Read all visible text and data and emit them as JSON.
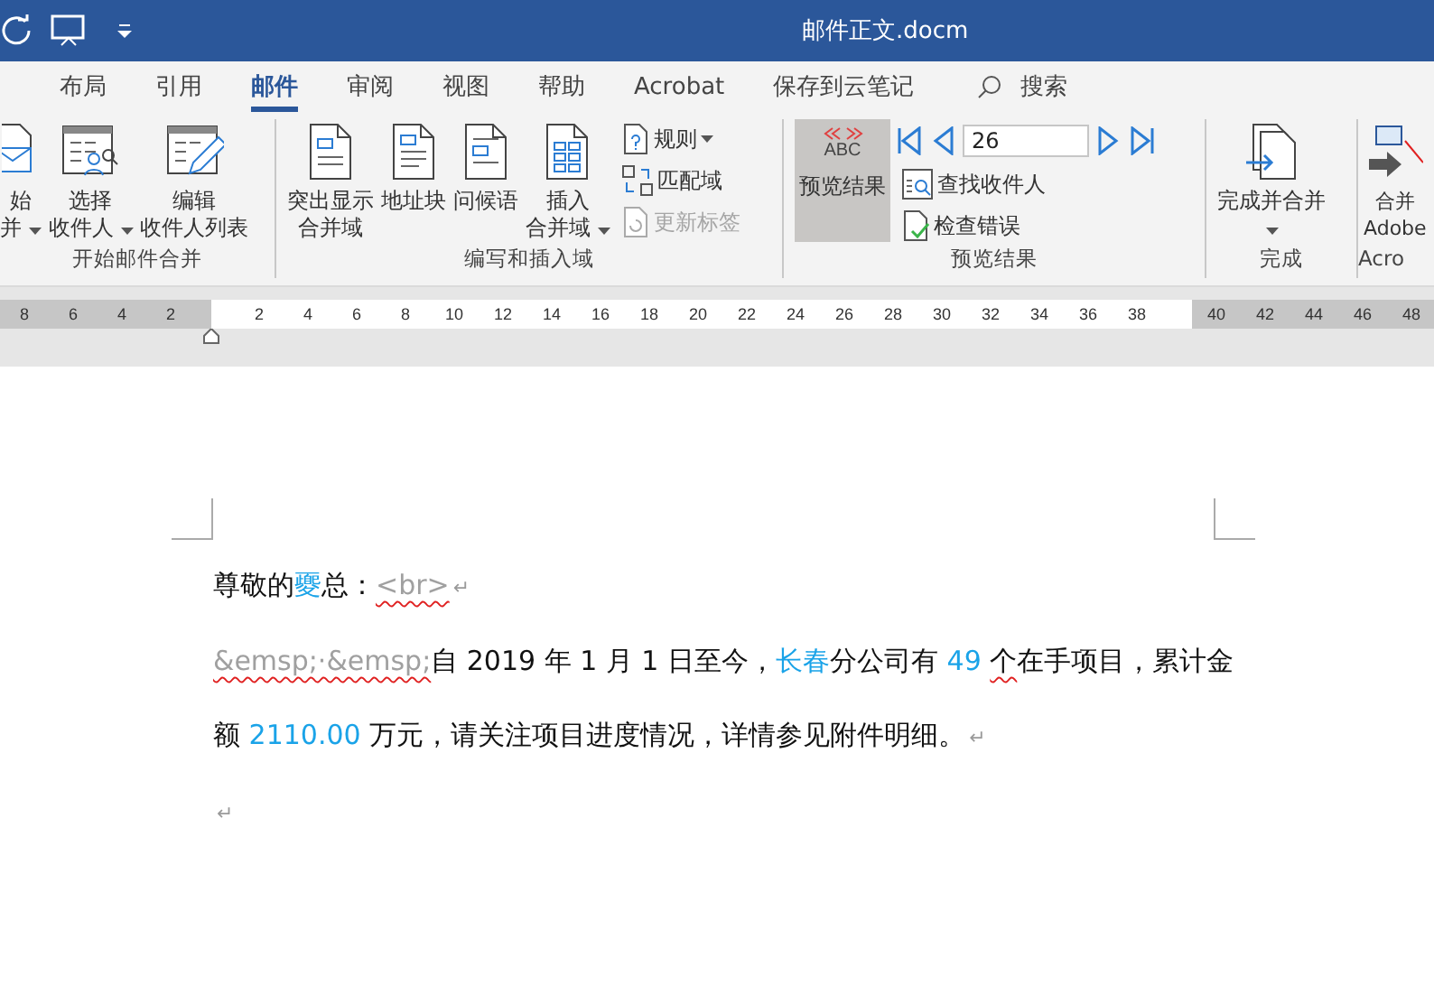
{
  "window": {
    "title": "邮件正文.docm"
  },
  "tabs": [
    {
      "label": "布局",
      "selected": false
    },
    {
      "label": "引用",
      "selected": false
    },
    {
      "label": "邮件",
      "selected": true
    },
    {
      "label": "审阅",
      "selected": false
    },
    {
      "label": "视图",
      "selected": false
    },
    {
      "label": "帮助",
      "selected": false
    },
    {
      "label": "Acrobat",
      "selected": false
    },
    {
      "label": "保存到云笔记",
      "selected": false
    }
  ],
  "search": {
    "label": "搜索"
  },
  "ribbon": {
    "groups": [
      {
        "label": "开始邮件合并",
        "items": [
          {
            "kind": "large",
            "lines": [
              "始",
              "并"
            ],
            "dropdown": true
          },
          {
            "kind": "large",
            "lines": [
              "选择",
              "收件人"
            ],
            "dropdown": true
          },
          {
            "kind": "large",
            "lines": [
              "编辑",
              "收件人列表"
            ],
            "dropdown": false
          }
        ]
      },
      {
        "label": "编写和插入域",
        "items": [
          {
            "kind": "large",
            "lines": [
              "突出显示",
              "合并域"
            ],
            "dropdown": false
          },
          {
            "kind": "large",
            "lines": [
              "地址块"
            ],
            "dropdown": false
          },
          {
            "kind": "large",
            "lines": [
              "问候语"
            ],
            "dropdown": false
          },
          {
            "kind": "large",
            "lines": [
              "插入",
              "合并域"
            ],
            "dropdown": true
          },
          {
            "kind": "column",
            "children": [
              {
                "kind": "small",
                "label": "规则",
                "dropdown": true,
                "disabled": false
              },
              {
                "kind": "small",
                "label": "匹配域",
                "dropdown": false,
                "disabled": false
              },
              {
                "kind": "small",
                "label": "更新标签",
                "dropdown": false,
                "disabled": true
              }
            ]
          }
        ]
      },
      {
        "label": "预览结果",
        "items": [
          {
            "kind": "toggle",
            "caption": "ABC",
            "lines": [
              "预览结果"
            ],
            "pressed": true
          },
          {
            "kind": "column",
            "children": [
              {
                "kind": "nav",
                "value": "26"
              },
              {
                "kind": "small",
                "label": "查找收件人",
                "dropdown": false,
                "disabled": false
              },
              {
                "kind": "small",
                "label": "检查错误",
                "dropdown": false,
                "disabled": false
              }
            ]
          }
        ]
      },
      {
        "label": "完成",
        "items": [
          {
            "kind": "large",
            "lines": [
              "完成并合并"
            ],
            "dropdown": true
          }
        ]
      },
      {
        "label": "Acro",
        "items": [
          {
            "kind": "large",
            "lines": [
              "合并",
              "Adobe"
            ],
            "dropdown": false
          }
        ]
      }
    ]
  },
  "ruler": {
    "left_labels": [
      "8",
      "6",
      "4",
      "2"
    ],
    "labels": [
      "2",
      "4",
      "6",
      "8",
      "10",
      "12",
      "14",
      "16",
      "18",
      "20",
      "22",
      "24",
      "26",
      "28",
      "30",
      "32",
      "34",
      "36",
      "38"
    ],
    "right_labels": [
      "40",
      "42",
      "44",
      "46",
      "48"
    ]
  },
  "document": {
    "paragraphs": [
      {
        "runs": [
          {
            "text": "尊敬的",
            "kind": "normal",
            "spelling": false
          },
          {
            "text": "夒",
            "kind": "field",
            "spelling": false
          },
          {
            "text": "总：",
            "kind": "normal",
            "spelling": false
          },
          {
            "text": "<br>",
            "kind": "code",
            "spelling": true
          }
        ],
        "mark": "↵"
      },
      {
        "runs": [
          {
            "text": "&emsp;·&emsp;",
            "kind": "code",
            "spelling": true
          },
          {
            "text": "自 2019 年 1 月 1 日至今，",
            "kind": "normal",
            "spelling": false
          },
          {
            "text": "长春",
            "kind": "field",
            "spelling": false
          },
          {
            "text": "分公司有 ",
            "kind": "normal",
            "spelling": false
          },
          {
            "text": "49 ",
            "kind": "field",
            "spelling": false
          },
          {
            "text": "个",
            "kind": "normal",
            "spelling": true
          },
          {
            "text": "在手项目，累计金额 ",
            "kind": "normal",
            "spelling": false
          },
          {
            "text": "2110.00",
            "kind": "field",
            "spelling": false
          },
          {
            "text": " 万元，请关注项目进度情况，详情参见附件明细。",
            "kind": "normal",
            "spelling": false
          }
        ],
        "mark": "↵"
      },
      {
        "mark": "↵"
      }
    ]
  }
}
